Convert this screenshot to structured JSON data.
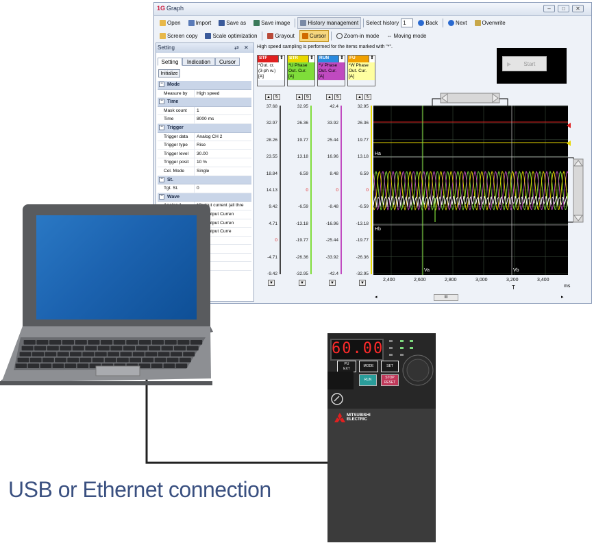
{
  "window": {
    "title": "Graph",
    "app_icon": "graph-app-icon",
    "controls": [
      "minimize",
      "maximize",
      "close"
    ]
  },
  "toolbar1": {
    "open": "Open",
    "import": "Import",
    "save_as": "Save as",
    "save_image": "Save image",
    "history_management": "History management",
    "select_history_label": "Select history",
    "select_history_value": "1",
    "back": "Back",
    "next": "Next",
    "overwrite": "Overwrite"
  },
  "toolbar2": {
    "screen_copy": "Screen copy",
    "scale_optimization": "Scale optimization",
    "grayout": "Grayout",
    "cursor": "Cursor",
    "zoom_in_mode": "Zoom-in mode",
    "moving_mode": "Moving mode"
  },
  "setting_panel": {
    "title": "Setting",
    "tabs": [
      "Setting",
      "Indication",
      "Cursor"
    ],
    "initialize": "Initialize",
    "categories": [
      {
        "name": "Mode",
        "rows": [
          {
            "k": "Measure by",
            "v": "High speed"
          }
        ]
      },
      {
        "name": "Time",
        "rows": [
          {
            "k": "Mask count",
            "v": "1"
          },
          {
            "k": "Time",
            "v": "8000 ms"
          }
        ]
      },
      {
        "name": "Trigger",
        "rows": [
          {
            "k": "Trigger data",
            "v": "Analog CH 2"
          },
          {
            "k": "Trigger type",
            "v": "Rise"
          },
          {
            "k": "Trigger level",
            "v": "30.00"
          },
          {
            "k": "Trigger posit",
            "v": "10 %"
          },
          {
            "k": "Col. Mode",
            "v": "Single"
          }
        ]
      },
      {
        "name": "St.",
        "rows": [
          {
            "k": "Tgt. St.",
            "v": "0"
          }
        ]
      },
      {
        "name": "Wave",
        "rows": [
          {
            "k": "Analog 1",
            "v": "*Output current (all thre"
          },
          {
            "k": "",
            "v": "ase Output Curren"
          },
          {
            "k": "",
            "v": "ase Output Curren"
          },
          {
            "k": "",
            "v": "ase Output Curre"
          }
        ]
      }
    ]
  },
  "plot": {
    "note": "High speed sampling is performed for the items marked with \"*\".",
    "start_button": "Start",
    "signals": [
      {
        "tag": "STF",
        "color": "#e02020",
        "body": [
          "*Out. cr.",
          "(3-ph w.)",
          "[A]"
        ],
        "bg": "#ffffff"
      },
      {
        "tag": "STR",
        "color": "#e8d800",
        "body": [
          "*U Phase",
          "Out. Cur.",
          "[A]"
        ],
        "bg": "#7fdd3a"
      },
      {
        "tag": "RUN",
        "color": "#2a8adf",
        "body": [
          "*V Phase",
          "Out. Cur.",
          "[A]"
        ],
        "bg": "#c04ac0"
      },
      {
        "tag": "FU",
        "color": "#f0a000",
        "body": [
          "*W Phase",
          "Out. Cur.",
          "[A]"
        ],
        "bg": "#ffffa0"
      }
    ],
    "axes": [
      [
        "37.68",
        "32.97",
        "28.26",
        "23.55",
        "18.84",
        "14.13",
        "9.42",
        "4.71",
        "0",
        "-4.71",
        "-9.42"
      ],
      [
        "32.95",
        "26.36",
        "19.77",
        "13.18",
        "6.59",
        "0",
        "-6.59",
        "-13.18",
        "-19.77",
        "-26.36",
        "-32.95"
      ],
      [
        "42.4",
        "33.92",
        "25.44",
        "16.96",
        "8.48",
        "0",
        "-8.48",
        "-16.96",
        "-25.44",
        "-33.92",
        "-42.4"
      ],
      [
        "32.95",
        "26.36",
        "19.77",
        "13.18",
        "6.59",
        "0",
        "-6.59",
        "-13.18",
        "-19.77",
        "-26.36",
        "-32.95"
      ]
    ],
    "cursor_labels": {
      "ha": "Ha",
      "hb": "Hb",
      "va": "Va",
      "vb": "Vb"
    },
    "x_ticks": [
      "2,400",
      "2,600",
      "2,800",
      "3,000",
      "3,200",
      "3,400"
    ],
    "x_unit": "ms",
    "t_label": "T",
    "hscroll_thumb": "III"
  },
  "inverter": {
    "display": "60.00",
    "brand_line1": "MITSUBISHI",
    "brand_line2": "ELECTRIC",
    "buttons": {
      "pu_ext_line1": "PU",
      "pu_ext_line2": "EXT",
      "mode": "MODE",
      "set": "SET",
      "run": "RUN",
      "stop_line1": "STOP",
      "stop_line2": "RESET"
    }
  },
  "caption": "USB or Ethernet connection",
  "colors": {
    "accent_toolbar_on": "#f7d77e",
    "plot_bg": "#000000",
    "caption": "#3a5080",
    "cable": "#222222"
  }
}
